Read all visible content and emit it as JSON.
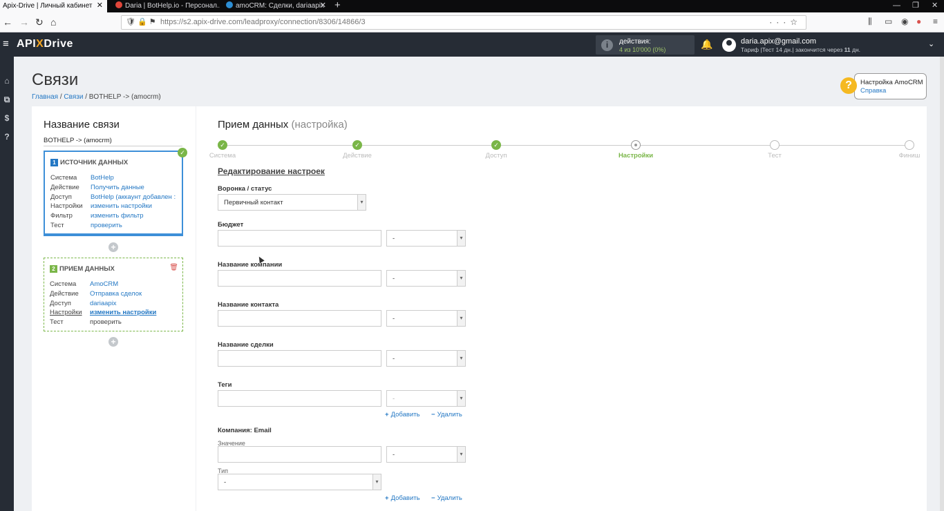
{
  "browser": {
    "tabs": [
      {
        "title": "Apix-Drive | Личный кабинет",
        "active": true
      },
      {
        "title": "Daria | BotHelp.io - Персонал...",
        "active": false
      },
      {
        "title": "amoCRM: Сделки, dariaapix",
        "active": false
      }
    ],
    "url": "https://s2.apix-drive.com/leadproxy/connection/8306/14866/3"
  },
  "header": {
    "logo_left": "API",
    "logo_x": "X",
    "logo_right": "Drive",
    "actions_label": "действия:",
    "actions_count": "4 из 10'000 (0%)",
    "user_email": "daria.apix@gmail.com",
    "user_plan_prefix": "Тариф |Тест 14 дн.| закончится через ",
    "user_plan_days": "11",
    "user_plan_suffix": " дн."
  },
  "page": {
    "title": "Связи",
    "breadcrumb": {
      "home": "Главная",
      "links": "Связи",
      "current": "BOTHELP -> (amocrm)"
    },
    "help": {
      "title": "Настройка AmoCRM",
      "link": "Справка"
    }
  },
  "left_panel": {
    "title": "Название связи",
    "connection_name": "BOTHELP -> (amocrm)",
    "source": {
      "number": "1",
      "title": "ИСТОЧНИК ДАННЫХ",
      "rows": [
        {
          "key": "Система",
          "value": "BotHelp"
        },
        {
          "key": "Действие",
          "value": "Получить данные"
        },
        {
          "key": "Доступ",
          "value": "BotHelp (аккаунт добавлен :"
        },
        {
          "key": "Настройки",
          "value": "изменить настройки"
        },
        {
          "key": "Фильтр",
          "value": "изменить фильтр"
        },
        {
          "key": "Тест",
          "value": "проверить"
        }
      ]
    },
    "receiver": {
      "number": "2",
      "title": "ПРИЕМ ДАННЫХ",
      "rows": [
        {
          "key": "Система",
          "value": "AmoCRM"
        },
        {
          "key": "Действие",
          "value": "Отправка сделок"
        },
        {
          "key": "Доступ",
          "value": "dariaapix"
        },
        {
          "key": "Настройки",
          "value": "изменить настройки"
        },
        {
          "key": "Тест",
          "value": "проверить"
        }
      ]
    }
  },
  "right_panel": {
    "title": "Прием данных",
    "title_sub": "(настройка)",
    "steps": [
      {
        "label": "Система",
        "state": "done"
      },
      {
        "label": "Действие",
        "state": "done"
      },
      {
        "label": "Доступ",
        "state": "done"
      },
      {
        "label": "Настройки",
        "state": "current"
      },
      {
        "label": "Тест",
        "state": "pending"
      },
      {
        "label": "Финиш",
        "state": "pending"
      }
    ],
    "section_title": "Редактирование настроек",
    "fields": {
      "funnel_label": "Воронка / статус",
      "funnel_value": "Первичный контакт",
      "budget_label": "Бюджет",
      "company_label": "Название компании",
      "contact_label": "Название контакта",
      "deal_label": "Название сделки",
      "tags_label": "Теги",
      "company_email_label": "Компания: Email",
      "value_label": "Значение",
      "type_label": "Тип",
      "dash": "-"
    },
    "add_label": "Добавить",
    "remove_label": "Удалить"
  }
}
